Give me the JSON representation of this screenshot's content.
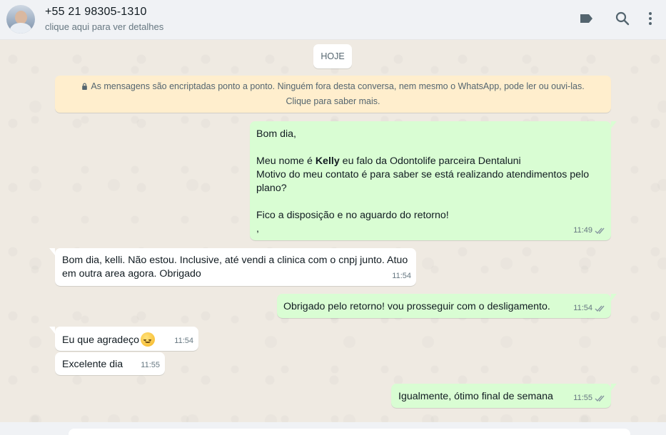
{
  "header": {
    "contact_name": "+55 21 98305-1310",
    "contact_subtitle": "clique aqui para ver detalhes",
    "icons": [
      "label-icon",
      "search-icon",
      "menu-icon"
    ]
  },
  "chat": {
    "date_chip": "HOJE",
    "encryption_notice": "As mensagens são encriptadas ponto a ponto. Ninguém fora desta conversa, nem mesmo o WhatsApp, pode ler ou ouvi-las. Clique para saber mais.",
    "messages": [
      {
        "direction": "out",
        "greeting": "Bom dia,",
        "line1_pre": "Meu nome é ",
        "line1_bold": "Kelly",
        "line1_post": " eu falo da Odontolife parceira Dentaluni",
        "line2": "Motivo do meu contato é para saber se está realizando atendimentos pelo plano?",
        "line3": "Fico a disposição e no aguardo do retorno!",
        "line4": ",",
        "time": "11:49",
        "status": "read"
      },
      {
        "direction": "in",
        "text": "Bom dia, kelli. Não estou. Inclusive, até vendi a clinica com o cnpj junto. Atuo em outra area agora. Obrigado",
        "time": "11:54"
      },
      {
        "direction": "out",
        "text": "Obrigado pelo retorno! vou prosseguir com o desligamento.",
        "time": "11:54",
        "status": "read"
      },
      {
        "direction": "in",
        "text": "Eu que agradeço",
        "emoji": "smiling-face-emoji",
        "time": "11:54"
      },
      {
        "direction": "in",
        "text": "Excelente dia",
        "time": "11:55"
      },
      {
        "direction": "out",
        "text": "Igualmente, ótimo final de semana",
        "time": "11:55",
        "status": "read"
      }
    ]
  },
  "colors": {
    "outgoing_bubble": "#d9fdd3",
    "incoming_bubble": "#ffffff",
    "chat_background": "#efeae2",
    "read_ticks": "#8696a0",
    "notice_background": "#ffeecd"
  }
}
